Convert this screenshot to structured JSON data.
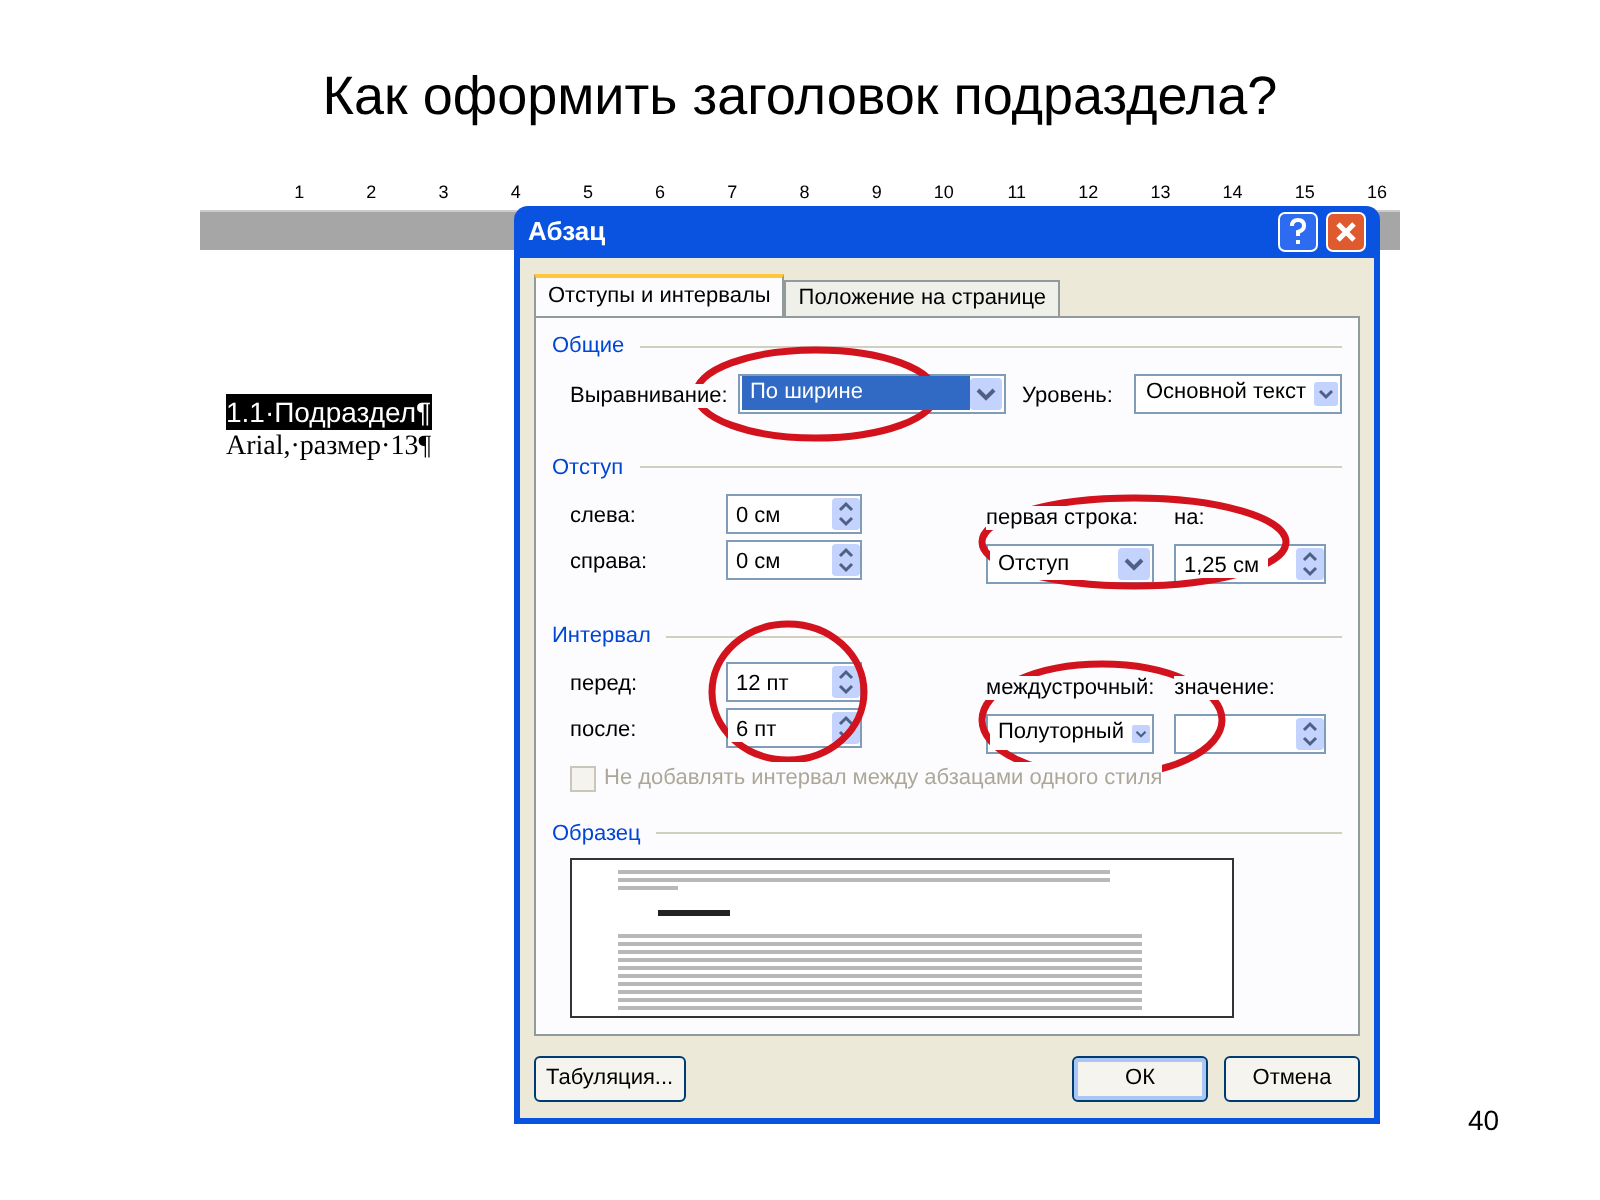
{
  "title": "Как оформить заголовок подраздела?",
  "ruler": {
    "numbers": [
      "1",
      "2",
      "3",
      "4",
      "5",
      "6",
      "7",
      "8",
      "9",
      "10",
      "11",
      "12",
      "13",
      "14",
      "15",
      "16"
    ]
  },
  "document_lines": [
    {
      "text": "1.1·Подраздел¶",
      "kind": "heading",
      "selected": true
    },
    {
      "text": "Arial,·размер·13¶",
      "kind": "note",
      "selected": false
    }
  ],
  "dialog": {
    "title": "Абзац",
    "tabs": [
      {
        "label": "Отступы и интервалы",
        "selected": true
      },
      {
        "label": "Положение на странице",
        "selected": false
      }
    ],
    "general": {
      "heading": "Общие",
      "alignment": {
        "label": "Выравнивание:",
        "value": "По ширине",
        "highlighted": true
      },
      "level": {
        "label": "Уровень:",
        "value": "Основной текст",
        "highlighted": false
      }
    },
    "indent": {
      "heading": "Отступ",
      "left": {
        "label": "слева:",
        "value": "0 см"
      },
      "right": {
        "label": "справа:",
        "value": "0 см"
      },
      "first_line": {
        "label": "первая строка:",
        "value": "Отступ",
        "highlighted": false
      },
      "by": {
        "label": "на:",
        "value": "1,25 см"
      }
    },
    "spacing": {
      "heading": "Интервал",
      "before": {
        "label": "перед:",
        "value": "12 пт"
      },
      "after": {
        "label": "после:",
        "value": "6 пт"
      },
      "line": {
        "label": "междустрочный:",
        "value": "Полуторный",
        "highlighted": false
      },
      "at": {
        "label": "значение:"
      },
      "no_space": {
        "label": "Не добавлять интервал между абзацами одного стиля",
        "checked": false,
        "disabled": true
      }
    },
    "preview": {
      "heading": "Образец"
    },
    "buttons": [
      {
        "label": "Табуляция...",
        "default": false
      },
      {
        "label": "ОК",
        "default": true
      },
      {
        "label": "Отмена",
        "default": false
      }
    ]
  },
  "page_number": "40"
}
